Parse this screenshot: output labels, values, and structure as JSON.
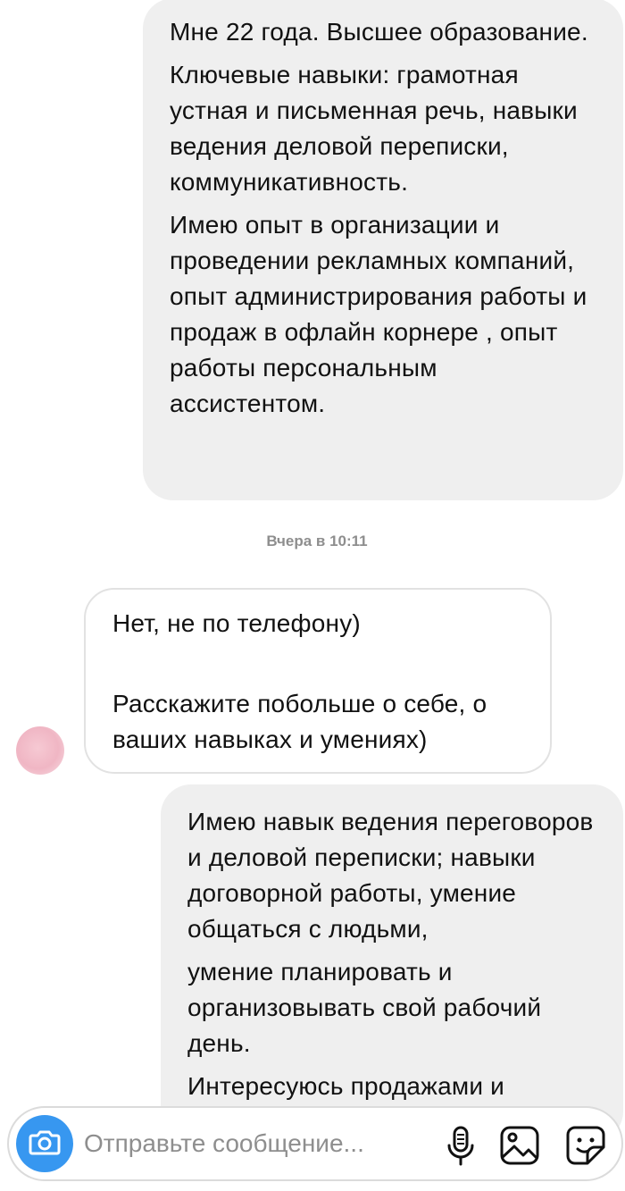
{
  "thread": {
    "messages": [
      {
        "direction": "outgoing",
        "paragraphs": [
          "Мне 22 года. Высшее образование.",
          "Ключевые навыки: грамотная устная и письменная речь, навыки ведения деловой переписки, коммуникативность.",
          "Имею опыт в организации и проведении рекламных компаний, опыт администрирования работы и продаж в офлайн корнере , опыт работы персональным ассистентом."
        ]
      },
      {
        "direction": "incoming",
        "paragraphs": [
          "Нет, не по телефону)",
          "Расскажите побольше о себе, о ваших навыках и умениях)"
        ]
      },
      {
        "direction": "outgoing",
        "paragraphs": [
          "Имею навык ведения переговоров и деловой переписки; навыки договорной работы, умение общаться с людьми,",
          "умение планировать и организовывать свой рабочий день.",
          "Интересуюсь продажами и"
        ]
      }
    ],
    "timestamp": "Вчера в 10:11"
  },
  "composer": {
    "placeholder": "Отправьте сообщение...",
    "value": "",
    "icons": {
      "camera": "camera-icon",
      "mic": "microphone-icon",
      "gallery": "image-gallery-icon",
      "sticker": "sticker-icon"
    },
    "accent_color": "#3797f0"
  },
  "colors": {
    "outgoing_bubble": "#efefef",
    "incoming_border": "#e2e2e2",
    "timestamp_text": "#8e8e8e"
  }
}
